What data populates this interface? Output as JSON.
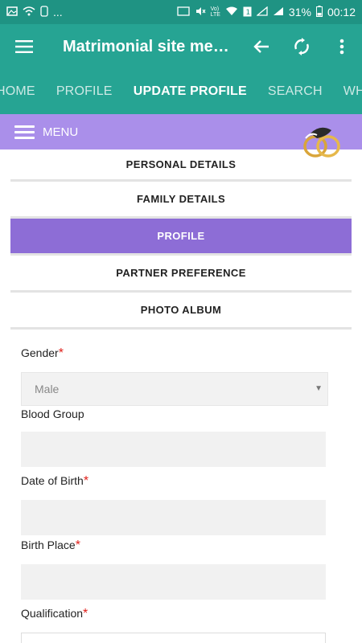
{
  "status": {
    "battery": "31%",
    "time": "00:12",
    "notif_dots": "..."
  },
  "appbar": {
    "title": "Matrimonial site me…",
    "menu_icon": "hamburger-icon",
    "back_icon": "arrow-left-icon",
    "refresh_icon": "refresh-icon",
    "more_icon": "more-vertical-icon"
  },
  "tabs": [
    {
      "label": "HOME"
    },
    {
      "label": "PROFILE"
    },
    {
      "label": "UPDATE PROFILE"
    },
    {
      "label": "SEARCH"
    },
    {
      "label": "WHO"
    }
  ],
  "menubar": {
    "label": "MENU"
  },
  "sections": [
    {
      "label": "PERSONAL DETAILS"
    },
    {
      "label": "FAMILY DETAILS"
    },
    {
      "label": "PROFILE"
    },
    {
      "label": "PARTNER PREFERENCE"
    },
    {
      "label": "PHOTO ALBUM"
    }
  ],
  "form": {
    "gender_label": "Gender",
    "gender_value": "Male",
    "blood_group_label": "Blood Group",
    "dob_label": "Date of Birth",
    "birth_place_label": "Birth Place",
    "qualification_label": "Qualification",
    "required_mark": "*"
  },
  "colors": {
    "appbar": "#26a493",
    "statusbar": "#1f9383",
    "menubar": "#aa8fea",
    "active_section": "#8d6dd6",
    "required": "#e0201a"
  }
}
